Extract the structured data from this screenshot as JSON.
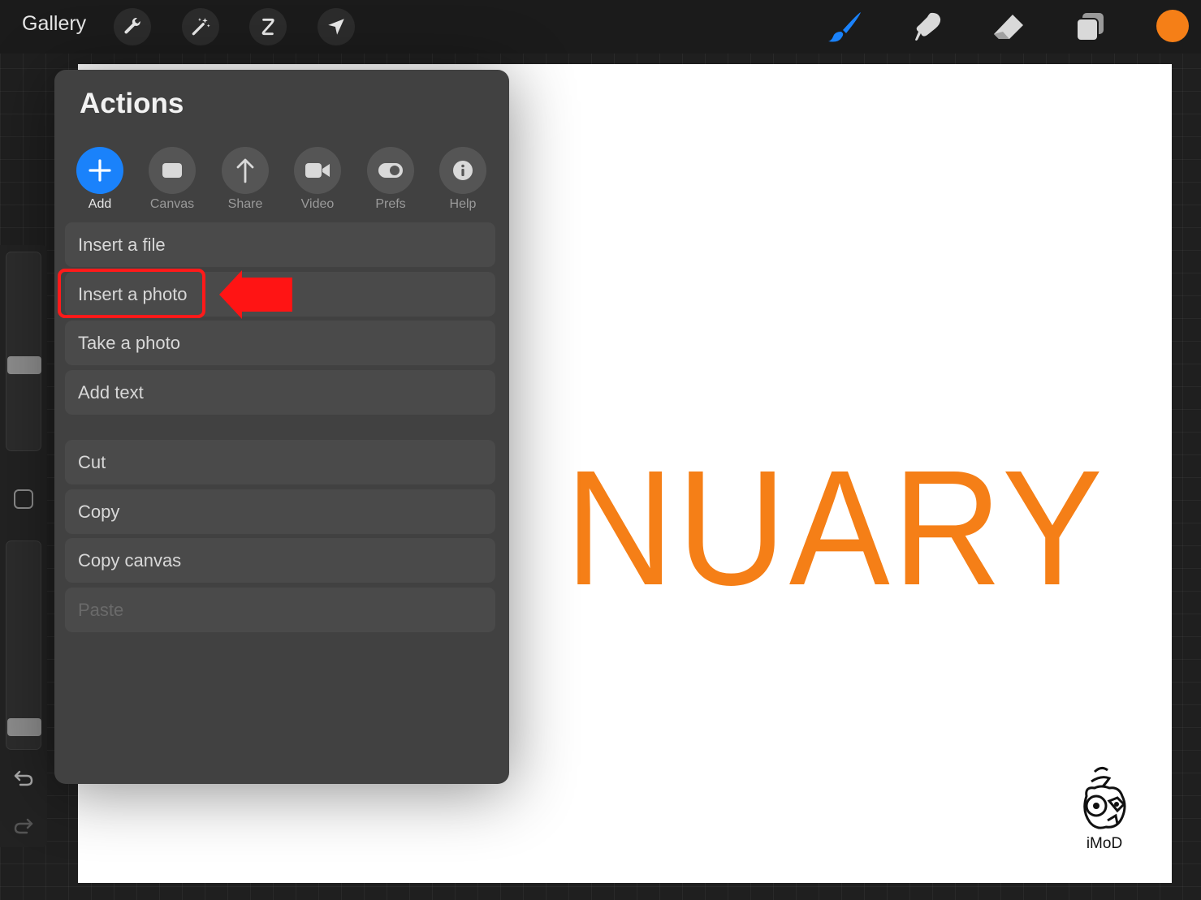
{
  "topbar": {
    "gallery_label": "Gallery",
    "left_tools": [
      "wrench-icon",
      "magic-wand-icon",
      "selection-icon",
      "transform-arrow-icon"
    ],
    "right_tools": [
      "brush-icon",
      "smudge-icon",
      "eraser-icon",
      "layers-icon"
    ],
    "active_color": "#f57f17",
    "brush_accent": "#1a82fb"
  },
  "canvas": {
    "text": "NUARY",
    "text_color": "#f57f17",
    "watermark": "iMoD"
  },
  "actions_panel": {
    "title": "Actions",
    "tabs": [
      {
        "label": "Add",
        "icon": "plus-icon",
        "active": true
      },
      {
        "label": "Canvas",
        "icon": "canvas-icon",
        "active": false
      },
      {
        "label": "Share",
        "icon": "share-arrow-icon",
        "active": false
      },
      {
        "label": "Video",
        "icon": "video-camera-icon",
        "active": false
      },
      {
        "label": "Prefs",
        "icon": "toggle-icon",
        "active": false
      },
      {
        "label": "Help",
        "icon": "info-icon",
        "active": false
      }
    ],
    "group1": [
      "Insert a file",
      "Insert a photo",
      "Take a photo",
      "Add text"
    ],
    "group2": [
      "Cut",
      "Copy",
      "Copy canvas",
      "Paste"
    ],
    "disabled_item": "Paste",
    "highlighted_item": "Insert a photo"
  },
  "sidebar": {
    "size_level": 0.58,
    "opacity_level": 0.94
  }
}
